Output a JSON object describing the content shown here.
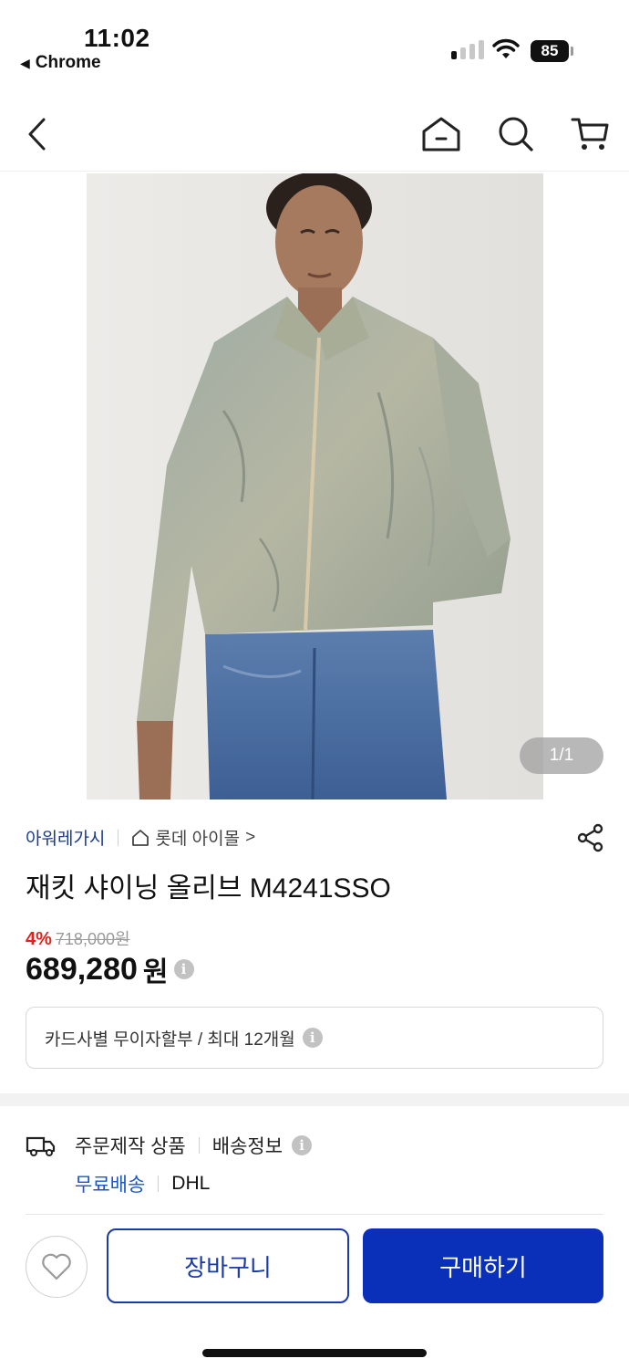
{
  "status_bar": {
    "time": "11:02",
    "back_app": "Chrome",
    "battery": "85",
    "icons": [
      "signal-icon",
      "wifi-icon",
      "battery-icon"
    ]
  },
  "nav": {
    "icons": [
      "back-arrow-icon",
      "home-icon",
      "search-icon",
      "cart-icon"
    ]
  },
  "gallery": {
    "counter": "1/1"
  },
  "product": {
    "brand": "아워레가시",
    "store": "롯데 아이몰",
    "store_chevron": ">",
    "name": "재킷 샤이닝 올리브 M4241SSO",
    "discount": "4%",
    "original_price": "718,000원",
    "price": "689,280",
    "price_unit": "원",
    "info_glyph": "i",
    "card_info": "카드사별 무이자할부 / 최대 12개월"
  },
  "delivery": {
    "type": "주문제작 상품",
    "info_label": "배송정보",
    "shipping": "무료배송",
    "carrier": "DHL"
  },
  "bottom": {
    "cart_label": "장바구니",
    "buy_label": "구매하기"
  },
  "colors": {
    "brand_blue": "#1a3a8f",
    "buy_button": "#0a2fb8",
    "discount_red": "#e0221b",
    "free_ship_blue": "#1a56c8"
  }
}
